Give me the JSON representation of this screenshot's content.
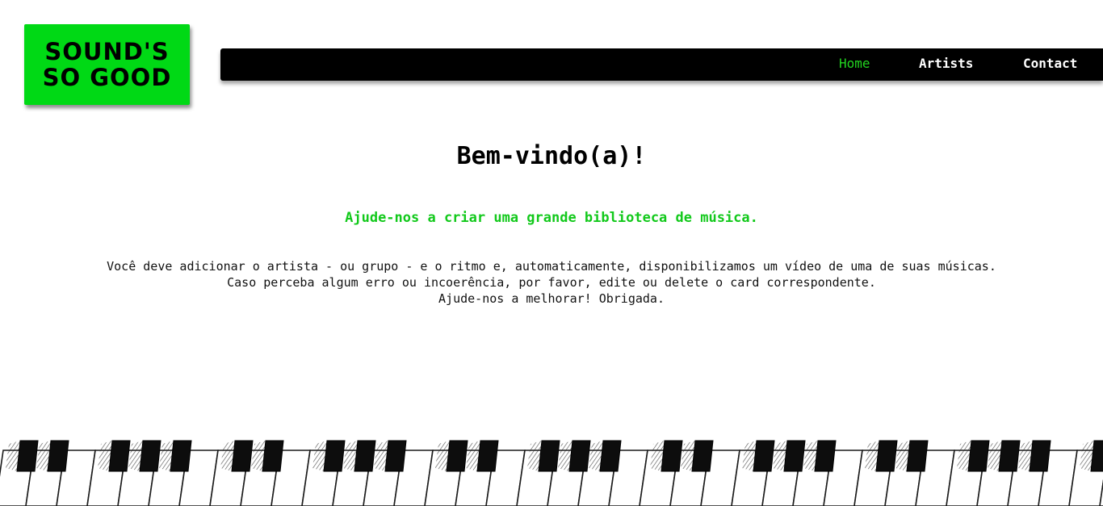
{
  "logo": {
    "line1": "SOUND'S",
    "line2": "SO GOOD"
  },
  "nav": {
    "items": [
      {
        "label": "Home",
        "active": true
      },
      {
        "label": "Artists",
        "active": false
      },
      {
        "label": "Contact",
        "active": false
      }
    ]
  },
  "main": {
    "title": "Bem-vindo(a)!",
    "subtitle": "Ajude-nos a criar uma grande biblioteca de música.",
    "paragraph": [
      "Você deve adicionar o artista - ou grupo - e o ritmo e, automaticamente, disponibilizamos um vídeo de uma de suas músicas.",
      "Caso perceba algum erro ou incoerência, por favor, edite ou delete o card correspondente.",
      "Ajude-nos a melhorar! Obrigada."
    ]
  },
  "colors": {
    "accent": "#00d915",
    "nav_background": "#000000",
    "active_nav": "#22d31f",
    "subtitle": "#12c91b"
  },
  "decoration": {
    "footer_image": "piano-keys"
  }
}
